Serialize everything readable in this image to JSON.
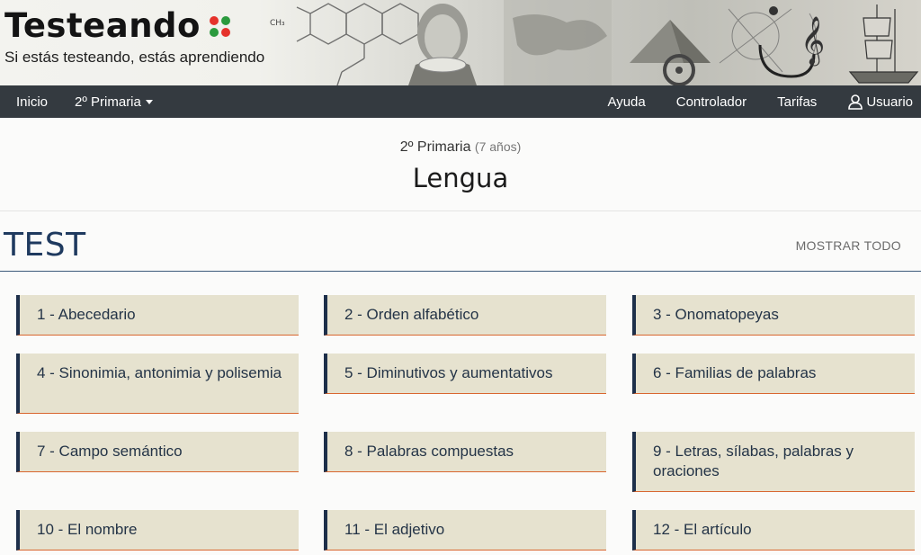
{
  "header": {
    "brand_title": "Testeando",
    "tagline": "Si estás testeando, estás aprendiendo",
    "dot_colors": [
      "#e5322b",
      "#2b9a3d",
      "#2b9a3d",
      "#e5322b"
    ]
  },
  "nav": {
    "left": [
      {
        "label": "Inicio"
      },
      {
        "label": "2º Primaria"
      }
    ],
    "right": [
      {
        "label": "Ayuda"
      },
      {
        "label": "Controlador"
      },
      {
        "label": "Tarifas"
      },
      {
        "label": "Usuario"
      }
    ]
  },
  "course": {
    "level": "2º Primaria",
    "age": "(7 años)",
    "subject": "Lengua"
  },
  "section": {
    "title": "TEST",
    "show_all": "MOSTRAR TODO"
  },
  "tests": [
    {
      "label": "1 - Abecedario"
    },
    {
      "label": "2 - Orden alfabético"
    },
    {
      "label": "3 - Onomatopeyas"
    },
    {
      "label": "4 - Sinonimia, antonimia y polisemia"
    },
    {
      "label": "5 - Diminutivos y aumentativos"
    },
    {
      "label": "6 - Familias de palabras"
    },
    {
      "label": "7 - Campo semántico"
    },
    {
      "label": "8 - Palabras compuestas"
    },
    {
      "label": "9 - Letras, sílabas, palabras y oraciones"
    },
    {
      "label": "10 - El nombre"
    },
    {
      "label": "11 - El adjetivo"
    },
    {
      "label": "12 - El artículo"
    }
  ]
}
